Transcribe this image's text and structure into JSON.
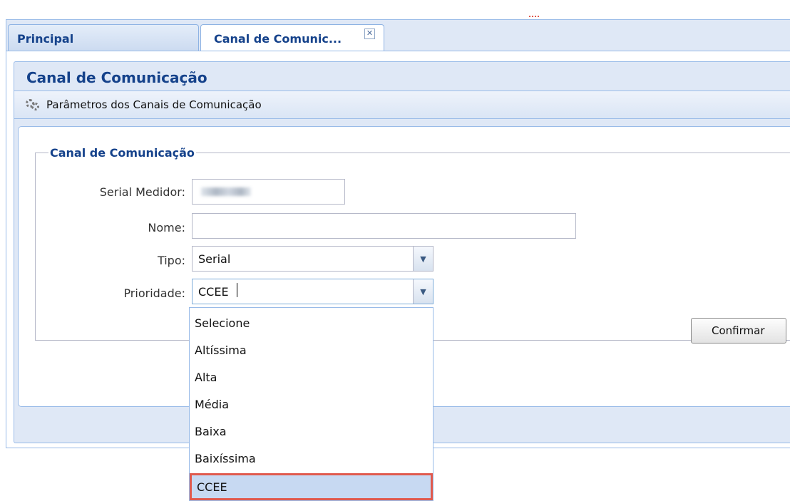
{
  "tabs": {
    "principal": "Principal",
    "canal": "Canal de Comunic..."
  },
  "window": {
    "title": "Canal de Comunicação",
    "subheader": "Parâmetros dos Canais de Comunicação"
  },
  "form": {
    "legend": "Canal de Comunicação",
    "serial_label": "Serial Medidor:",
    "nome_label": "Nome:",
    "nome_value": "",
    "tipo_label": "Tipo:",
    "tipo_value": "Serial",
    "prioridade_label": "Prioridade:",
    "prioridade_value": "CCEE",
    "confirm_label": "Confirmar"
  },
  "dropdown": {
    "options": [
      "Selecione",
      "Altíssima",
      "Alta",
      "Média",
      "Baixa",
      "Baixíssima",
      "CCEE"
    ],
    "selected": "CCEE"
  },
  "colors": {
    "title_blue": "#15428b",
    "panel_border": "#99bbe8",
    "highlight_border": "#e05a4e"
  }
}
